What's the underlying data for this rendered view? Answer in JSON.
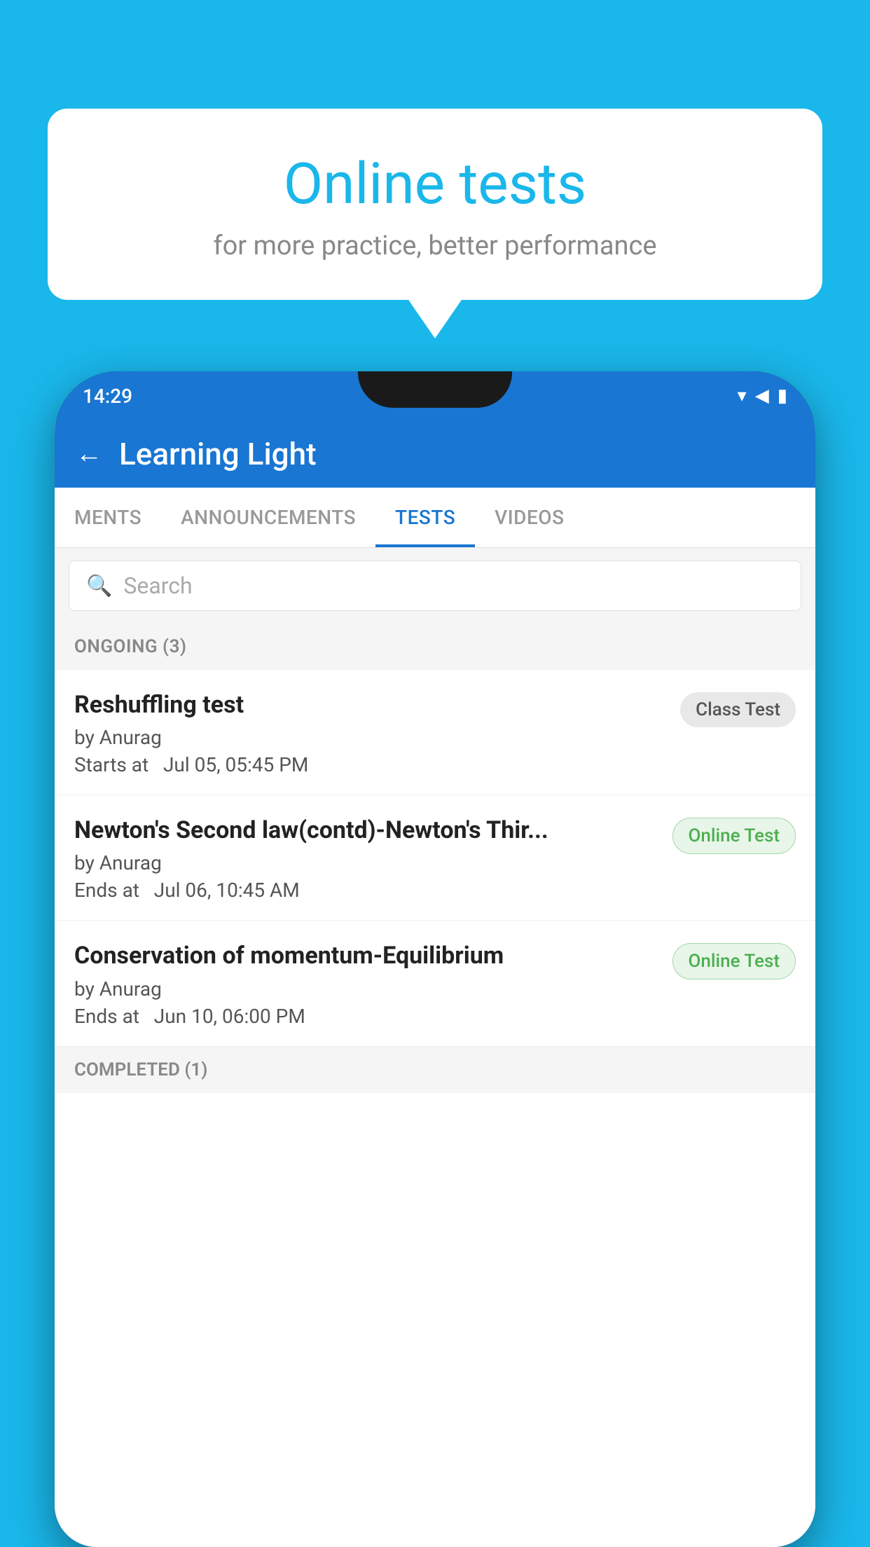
{
  "background": {
    "color": "#1ab7ea"
  },
  "speech_bubble": {
    "title": "Online tests",
    "subtitle": "for more practice, better performance"
  },
  "phone": {
    "status_bar": {
      "time": "14:29",
      "wifi_icon": "▾",
      "signal_icon": "▲",
      "battery_icon": "▮"
    },
    "header": {
      "back_label": "←",
      "title": "Learning Light"
    },
    "tabs": [
      {
        "label": "MENTS",
        "active": false
      },
      {
        "label": "ANNOUNCEMENTS",
        "active": false
      },
      {
        "label": "TESTS",
        "active": true
      },
      {
        "label": "VIDEOS",
        "active": false
      }
    ],
    "search": {
      "placeholder": "Search"
    },
    "ongoing_section": {
      "label": "ONGOING (3)"
    },
    "tests": [
      {
        "name": "Reshuffling test",
        "author": "by Anurag",
        "time_label": "Starts at",
        "time": "Jul 05, 05:45 PM",
        "badge": "Class Test",
        "badge_type": "class"
      },
      {
        "name": "Newton's Second law(contd)-Newton's Thir...",
        "author": "by Anurag",
        "time_label": "Ends at",
        "time": "Jul 06, 10:45 AM",
        "badge": "Online Test",
        "badge_type": "online"
      },
      {
        "name": "Conservation of momentum-Equilibrium",
        "author": "by Anurag",
        "time_label": "Ends at",
        "time": "Jun 10, 06:00 PM",
        "badge": "Online Test",
        "badge_type": "online"
      }
    ],
    "completed_section": {
      "label": "COMPLETED (1)"
    }
  }
}
